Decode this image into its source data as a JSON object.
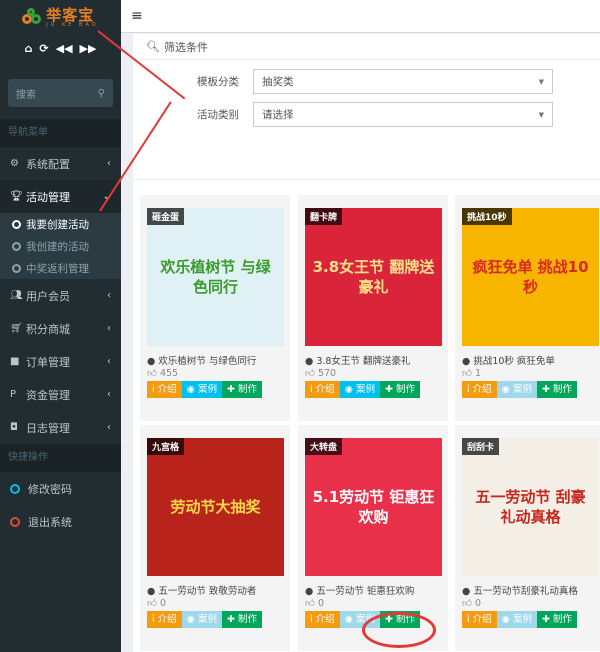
{
  "logo": {
    "name": "举客宝",
    "sub": "JU KE BAO"
  },
  "quick_icons": [
    "home-icon",
    "refresh-icon",
    "backward-icon",
    "forward-icon"
  ],
  "search": {
    "placeholder": "搜索"
  },
  "nav_header": "导航菜单",
  "menu": [
    {
      "label": "系统配置",
      "icon": "gear-icon"
    },
    {
      "label": "活动管理",
      "icon": "trophy-icon",
      "expanded": true,
      "children": [
        {
          "label": "我要创建活动",
          "active": true
        },
        {
          "label": "我创建的活动"
        },
        {
          "label": "中奖返利管理"
        }
      ]
    },
    {
      "label": "用户会员",
      "icon": "users-icon"
    },
    {
      "label": "积分商城",
      "icon": "cart-icon"
    },
    {
      "label": "订单管理",
      "icon": "truck-icon"
    },
    {
      "label": "资金管理",
      "icon": "paypal-icon"
    },
    {
      "label": "日志管理",
      "icon": "shield-icon"
    }
  ],
  "quick_header": "快捷操作",
  "quick_ops": [
    {
      "label": "修改密码",
      "color": "#00c0ef"
    },
    {
      "label": "退出系统",
      "color": "#dd4b39"
    }
  ],
  "filter": {
    "title": "筛选条件",
    "template_label": "模板分类",
    "template_value": "抽奖类",
    "activity_label": "活动类别",
    "activity_value": "请选择"
  },
  "buttons": {
    "intro": "i 介绍",
    "case": "◉ 案例",
    "make": "✚ 制作"
  },
  "cards": [
    {
      "tag": "砸金蛋",
      "poster": "欢乐植树节 与绿色同行",
      "title": "欢乐植树节 与绿色同行",
      "likes": "455",
      "bg": "#dff1f5",
      "fg": "#3a9a2a"
    },
    {
      "tag": "翻卡牌",
      "poster": "3.8女王节 翻牌送豪礼",
      "title": "3.8女王节 翻牌送豪礼",
      "likes": "570",
      "bg": "#d9243a",
      "fg": "#ffe08a"
    },
    {
      "tag": "挑战10秒",
      "poster": "疯狂免单 挑战10秒",
      "title": "挑战10秒 疯狂免单",
      "likes": "1",
      "bg": "#f7b500",
      "fg": "#d62b1f",
      "dim": true
    },
    {
      "tag": "九宫格",
      "poster": "劳动节大抽奖",
      "title": "五一劳动节 致敬劳动者",
      "likes": "0",
      "bg": "#b8241c",
      "fg": "#ffd84a",
      "dim": true
    },
    {
      "tag": "大转盘",
      "poster": "5.1劳动节 钜惠狂欢购",
      "title": "五一劳动节 钜惠狂欢购",
      "likes": "0",
      "bg": "#e8304a",
      "fg": "#fff",
      "dim": true
    },
    {
      "tag": "刮刮卡",
      "poster": "五一劳动节 刮豪礼动真格",
      "title": "五一劳动节刮豪礼动真格",
      "likes": "0",
      "bg": "#f3efe6",
      "fg": "#c8261d",
      "dim": true
    }
  ]
}
